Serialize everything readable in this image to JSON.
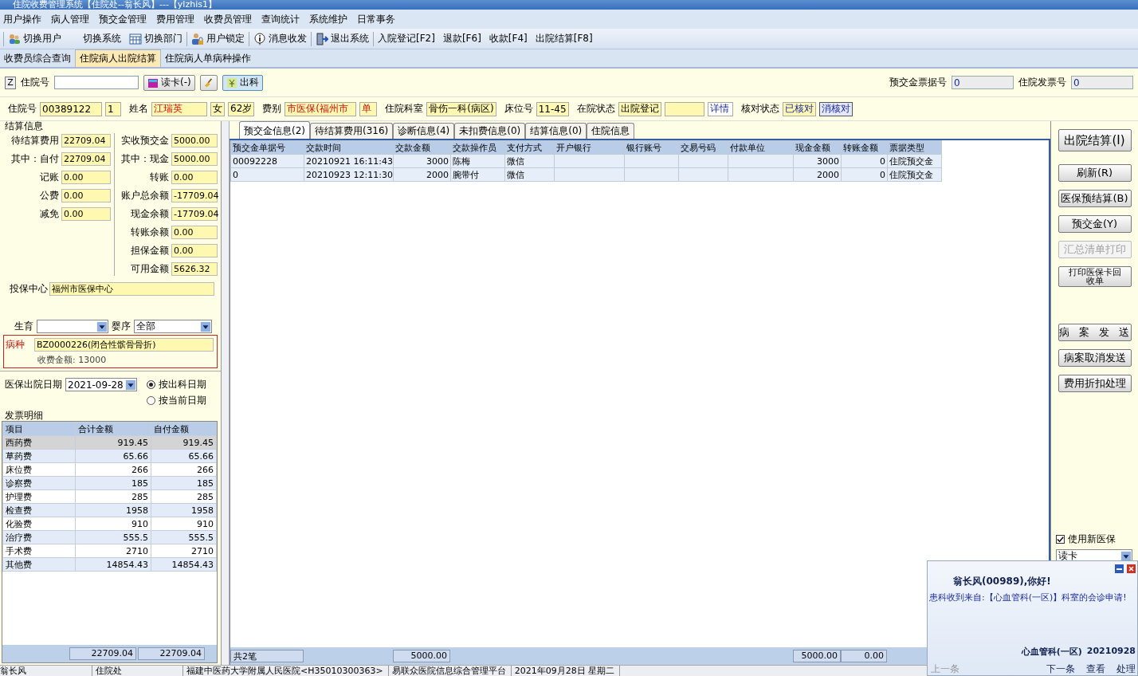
{
  "window": {
    "title": "住院收费管理系统【住院处--翁长风】---【ylzhis1】"
  },
  "menu": [
    "用户操作",
    "病人管理",
    "预交金管理",
    "费用管理",
    "收费员管理",
    "查询统计",
    "系统维护",
    "日常事务"
  ],
  "toolbar": [
    {
      "label": "切换用户",
      "kind": "users"
    },
    {
      "label": "切换系统",
      "kind": "plain"
    },
    {
      "label": "切换部门",
      "kind": "grid"
    },
    {
      "label": "用户锁定",
      "kind": "lock"
    },
    {
      "label": "消息收发",
      "kind": "info"
    },
    {
      "label": "退出系统",
      "kind": "exit"
    },
    {
      "label": "入院登记[F2]",
      "kind": "plain"
    },
    {
      "label": "退款[F6]",
      "kind": "plain"
    },
    {
      "label": "收款[F4]",
      "kind": "plain"
    },
    {
      "label": "出院结算[F8]",
      "kind": "plain"
    }
  ],
  "page_tabs": [
    {
      "label": "收费员综合查询",
      "selected": false
    },
    {
      "label": "住院病人出院结算",
      "selected": true
    },
    {
      "label": "住院病人单病种操作",
      "selected": false
    }
  ],
  "search": {
    "z_key": "Z",
    "label": "住院号",
    "read_card": "读卡(-)",
    "out_dept": "出科",
    "deposit_receipt_label": "预交金票据号",
    "deposit_receipt_value": "0",
    "invoice_label": "住院发票号",
    "invoice_value": "0"
  },
  "patient": [
    {
      "label": "住院号",
      "value": "00389122",
      "kind": "field"
    },
    {
      "value": "1",
      "kind": "field"
    },
    {
      "label": "姓名",
      "value": "江瑞英",
      "kind": "alert"
    },
    {
      "value": "女",
      "kind": "field"
    },
    {
      "value": "62岁",
      "kind": "field"
    },
    {
      "label": "费别",
      "value": "市医保(福州市",
      "kind": "alert"
    },
    {
      "value": "单",
      "kind": "alert"
    },
    {
      "label": "住院科室",
      "value": "骨伤一科(病区)",
      "kind": "field"
    },
    {
      "label": "床位号",
      "value": "11-45",
      "kind": "field"
    },
    {
      "label": "在院状态",
      "value": "出院登记",
      "kind": "field"
    },
    {
      "kind": "field"
    },
    {
      "value": "详情",
      "kind": "link"
    },
    {
      "label": "核对状态",
      "value": "已核对",
      "kind": "info"
    },
    {
      "value": "消核对",
      "kind": "button"
    }
  ],
  "settlement": {
    "title": "结算信息",
    "left": [
      {
        "label": "待结算费用",
        "value": "22709.04"
      },
      {
        "label": "其中：自付",
        "value": "22709.04"
      },
      {
        "label": "记账",
        "value": "0.00"
      },
      {
        "label": "公费",
        "value": "0.00"
      },
      {
        "label": "减免",
        "value": "0.00"
      }
    ],
    "right": [
      {
        "label": "实收预交金",
        "value": "5000.00"
      },
      {
        "label": "其中：现金",
        "value": "5000.00"
      },
      {
        "label": "转账",
        "value": "0.00"
      },
      {
        "label": "账户总余额",
        "value": "-17709.04"
      },
      {
        "label": "现金余额",
        "value": "-17709.04"
      },
      {
        "label": "转账余额",
        "value": "0.00"
      },
      {
        "label": "担保金额",
        "value": "0.00"
      },
      {
        "label": "可用金额",
        "value": "5626.32"
      }
    ],
    "insurer_label": "投保中心",
    "insurer_value": "福州市医保中心"
  },
  "birth": {
    "label": "生育",
    "infant_label": "婴序",
    "infant_value": "全部"
  },
  "disease": {
    "label": "病种",
    "value": "BZ0000226(闭合性髌骨骨折)",
    "fee": "收费金额: 13000"
  },
  "discharge": {
    "label": "医保出院日期",
    "value": "2021-09-28",
    "options": [
      {
        "label": "按出科日期",
        "selected": true
      },
      {
        "label": "按当前日期",
        "selected": false
      }
    ]
  },
  "invoice": {
    "title": "发票明细",
    "columns": [
      "项目",
      "合计金额",
      "自付金额"
    ],
    "rows": [
      {
        "cells": [
          "西药费",
          "919.45",
          "919.45"
        ],
        "selected": true
      },
      {
        "cells": [
          "草药费",
          "65.66",
          "65.66"
        ],
        "selected": false
      },
      {
        "cells": [
          "床位费",
          "266",
          "266"
        ],
        "selected": false
      },
      {
        "cells": [
          "诊察费",
          "185",
          "185"
        ],
        "selected": false
      },
      {
        "cells": [
          "护理费",
          "285",
          "285"
        ],
        "selected": false
      },
      {
        "cells": [
          "检查费",
          "1958",
          "1958"
        ],
        "selected": false
      },
      {
        "cells": [
          "化验费",
          "910",
          "910"
        ],
        "selected": false
      },
      {
        "cells": [
          "治疗费",
          "555.5",
          "555.5"
        ],
        "selected": false
      },
      {
        "cells": [
          "手术费",
          "2710",
          "2710"
        ],
        "selected": false
      },
      {
        "cells": [
          "其他费",
          "14854.43",
          "14854.43"
        ],
        "selected": false
      }
    ],
    "totals": [
      "22709.04",
      "22709.04"
    ]
  },
  "data_tabs": [
    {
      "label": "预交金信息(2)",
      "selected": true
    },
    {
      "label": "待结算费用(316)",
      "selected": false
    },
    {
      "label": "诊断信息(4)",
      "selected": false
    },
    {
      "label": "未扣费信息(0)",
      "selected": false
    },
    {
      "label": "结算信息(0)",
      "selected": false
    },
    {
      "label": "住院信息",
      "selected": false
    }
  ],
  "deposits": {
    "columns": [
      "预交金单据号",
      "交款时间",
      "交款金额",
      "交款操作员",
      "支付方式",
      "开户银行",
      "银行账号",
      "交易号码",
      "付款单位",
      "现金金额",
      "转账金额",
      "票据类型"
    ],
    "rows": [
      [
        "00092228",
        "20210921 16:11:43",
        "3000",
        "陈梅",
        "微信",
        "",
        "",
        "",
        "",
        "3000",
        "0",
        "住院预交金"
      ],
      [
        "0",
        "20210923 12:11:30",
        "2000",
        "腕带付",
        "微信",
        "",
        "",
        "",
        "",
        "2000",
        "0",
        "住院预交金"
      ]
    ],
    "footer": {
      "count": "共2笔",
      "deposit_total": "5000.00",
      "cash_total": "5000.00",
      "transfer_total": "0.00"
    }
  },
  "actions": [
    {
      "label": "出院结算(I)",
      "kind": "large",
      "disabled": false
    },
    {
      "label": "刷新(R)",
      "kind": "normal",
      "disabled": false
    },
    {
      "label": "医保预结算(B)",
      "kind": "normal",
      "disabled": false
    },
    {
      "label": "预交金(Y)",
      "kind": "normal",
      "disabled": false
    },
    {
      "label": "汇总清单打印",
      "kind": "normal",
      "disabled": true
    },
    {
      "label": "打印医保卡回收单",
      "kind": "small",
      "disabled": false
    },
    {
      "label": "病 案 发 送",
      "kind": "spaced",
      "disabled": false
    },
    {
      "label": "病案取消发送",
      "kind": "normal",
      "disabled": false
    },
    {
      "label": "费用折扣处理",
      "kind": "normal",
      "disabled": false
    }
  ],
  "new_insurance": {
    "label": "使用新医保",
    "checked": true
  },
  "card_mode": {
    "value": "读卡"
  },
  "notice": {
    "greeting": "翁长风(00989),你好!",
    "message": "患科收到来自:【心血管科(一区)】科室的会诊申请!",
    "sender": "心血管科(一区)",
    "date": "20210928",
    "links": [
      {
        "label": "上一条",
        "disabled": true
      },
      {
        "label": "下一条",
        "disabled": false
      },
      {
        "label": "查看",
        "disabled": false
      },
      {
        "label": "处理",
        "disabled": false
      }
    ]
  },
  "status_bar": [
    "翁长风",
    "住院处",
    "福建中医药大学附属人民医院<H35010300363>",
    "易联众医院信息综合管理平台",
    "2021年09月28日 星期二"
  ]
}
